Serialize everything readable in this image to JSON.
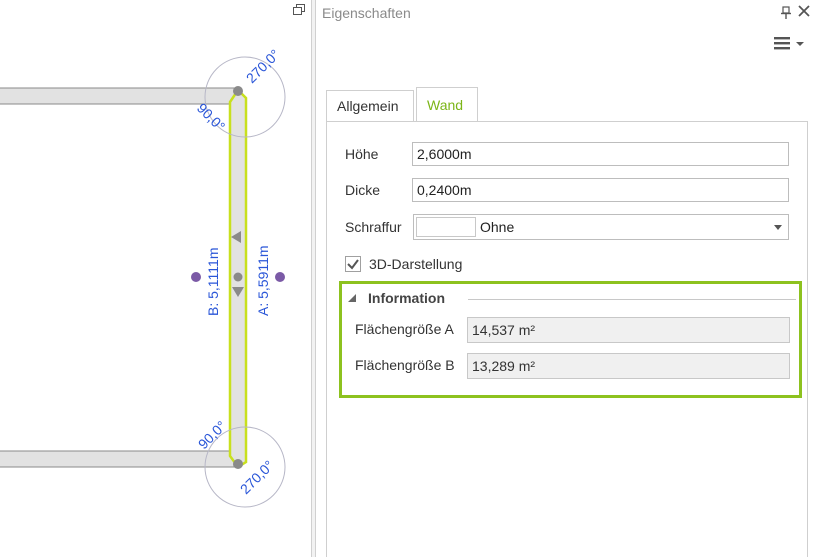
{
  "canvas": {
    "angle_top_outer": "270,0°",
    "angle_top_inner": "90,0°",
    "angle_bottom_inner": "90,0°",
    "angle_bottom_outer": "270,0°",
    "dimension_b": "B: 5,1111m",
    "dimension_a": "A: 5,5911m",
    "colors": {
      "wall_outline": "#c8e01e",
      "dimension_text": "#2a56d8",
      "handle": "#7b5aa6"
    }
  },
  "panel": {
    "title": "Eigenschaften",
    "icons": [
      "pin-icon",
      "close-icon",
      "hamburger-menu-icon",
      "restore-window-icon"
    ]
  },
  "tabs": [
    {
      "label": "Allgemein",
      "active": false
    },
    {
      "label": "Wand",
      "active": true
    }
  ],
  "fields": {
    "hoehe": {
      "label": "Höhe",
      "value": "2,6000m"
    },
    "dicke": {
      "label": "Dicke",
      "value": "0,2400m"
    },
    "schraffur": {
      "label": "Schraffur",
      "value": "Ohne"
    },
    "darstellung": {
      "label": "3D-Darstellung",
      "checked": true
    }
  },
  "information": {
    "title": "Information",
    "flaeche_a": {
      "label": "Flächengröße A",
      "value": "14,537 m²"
    },
    "flaeche_b": {
      "label": "Flächengröße B",
      "value": "13,289 m²"
    },
    "highlight_color": "#8dc21f"
  },
  "accent_color": "#7cb518"
}
